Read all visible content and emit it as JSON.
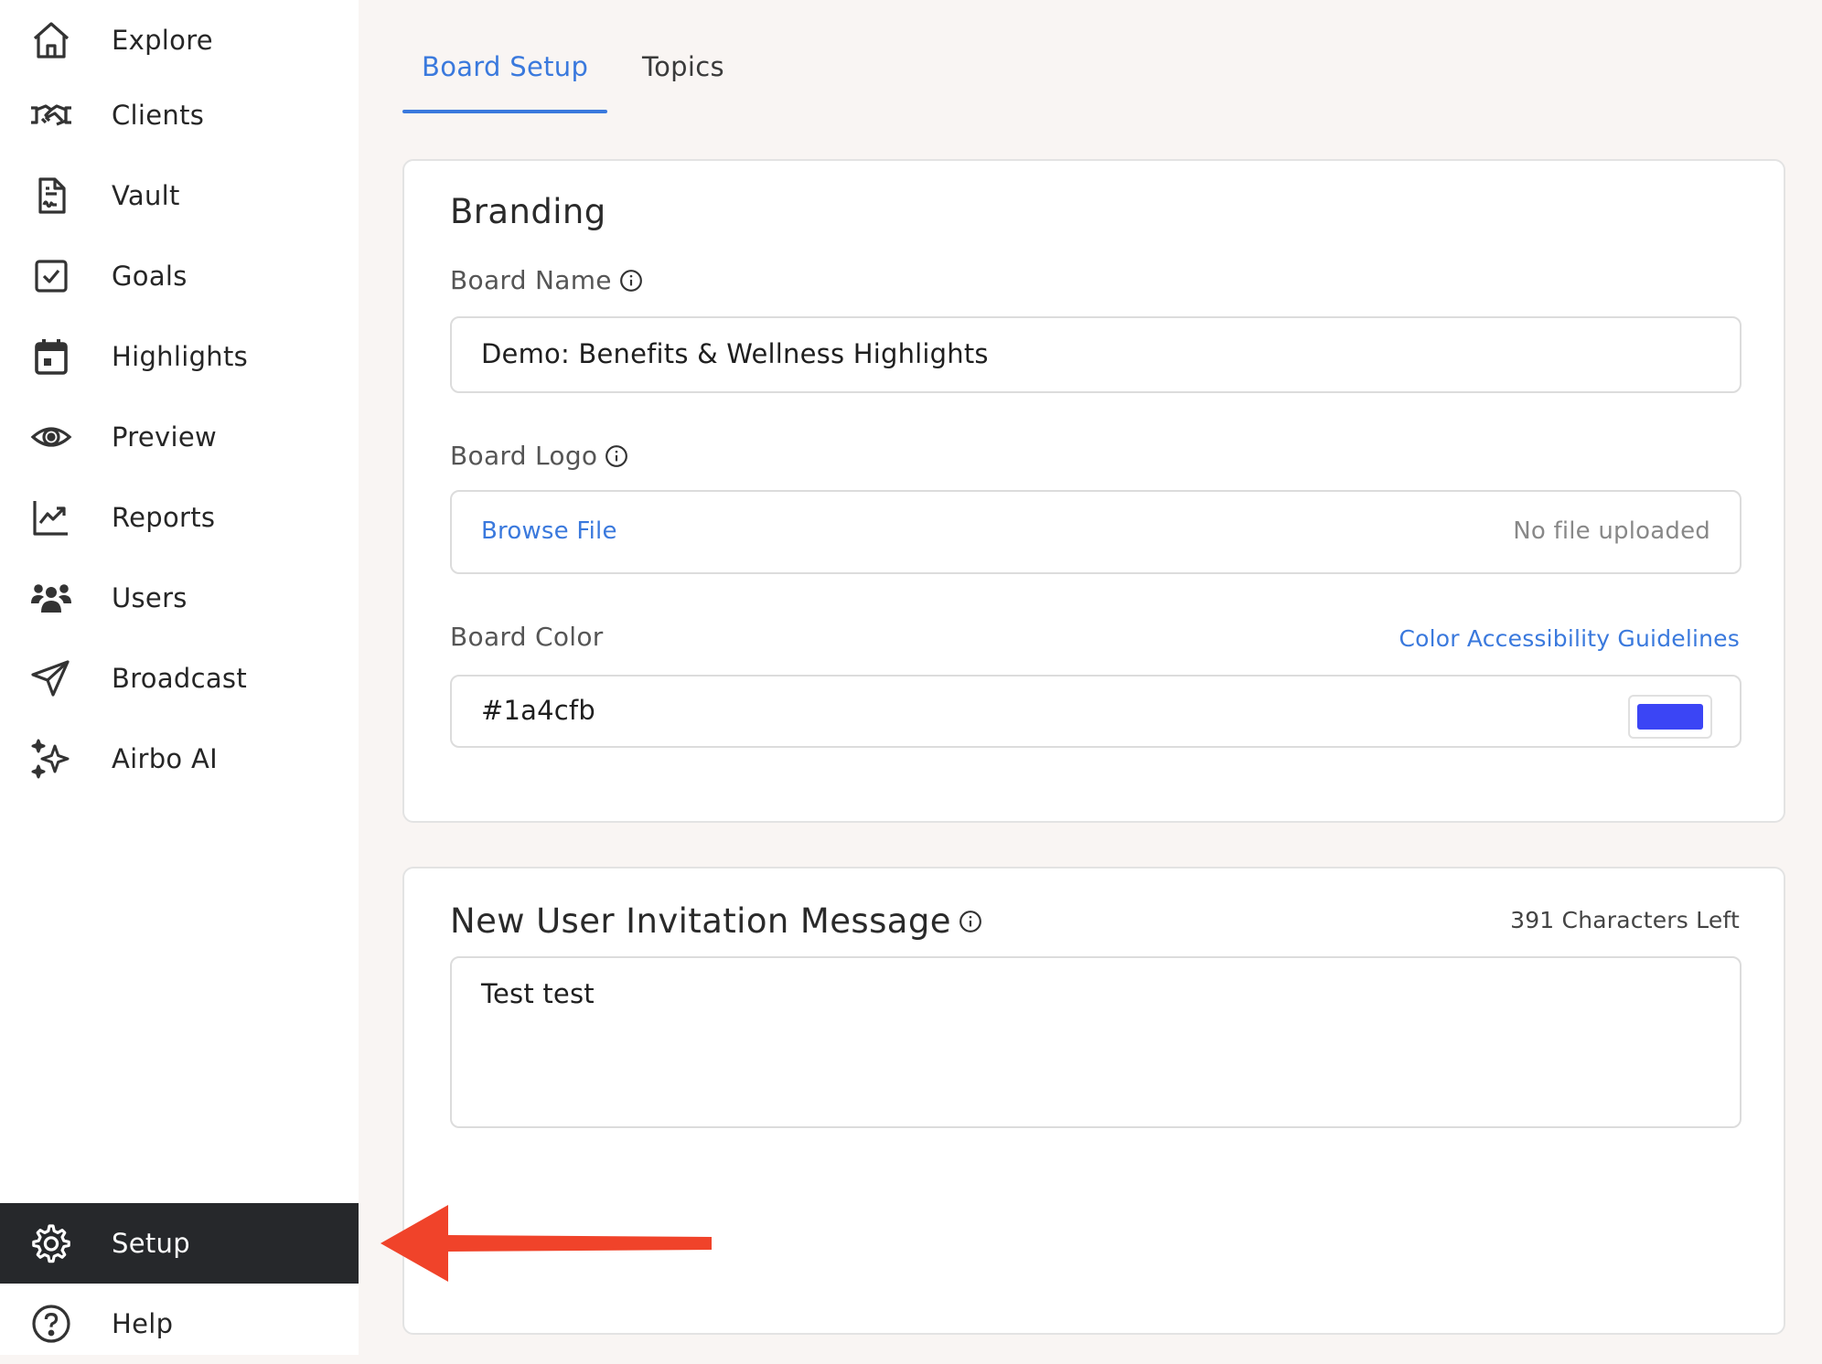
{
  "sidebar": {
    "items": [
      {
        "label": "Explore",
        "icon": "home-icon"
      },
      {
        "label": "Clients",
        "icon": "handshake-icon"
      },
      {
        "label": "Vault",
        "icon": "document-icon"
      },
      {
        "label": "Goals",
        "icon": "checkbox-icon"
      },
      {
        "label": "Highlights",
        "icon": "calendar-icon"
      },
      {
        "label": "Preview",
        "icon": "eye-icon"
      },
      {
        "label": "Reports",
        "icon": "chart-trend-icon"
      },
      {
        "label": "Users",
        "icon": "users-icon"
      },
      {
        "label": "Broadcast",
        "icon": "send-icon"
      },
      {
        "label": "Airbo AI",
        "icon": "sparkles-icon"
      }
    ],
    "setup": {
      "label": "Setup",
      "icon": "gear-icon",
      "active": true
    },
    "help": {
      "label": "Help",
      "icon": "question-circle-icon"
    }
  },
  "tabs": [
    {
      "label": "Board Setup",
      "active": true
    },
    {
      "label": "Topics",
      "active": false
    }
  ],
  "branding": {
    "title": "Branding",
    "board_name_label": "Board Name",
    "board_name_value": "Demo: Benefits & Wellness Highlights",
    "board_logo_label": "Board Logo",
    "browse_file": "Browse File",
    "no_file": "No file uploaded",
    "board_color_label": "Board Color",
    "color_guidelines_link": "Color Accessibility Guidelines",
    "board_color_value": "#1a4cfb",
    "swatch_color": "#3b45f5"
  },
  "invitation": {
    "title": "New User Invitation Message",
    "chars_left": "391 Characters Left",
    "message": "Test test"
  },
  "colors": {
    "accent": "#3a79dd",
    "active_nav_bg": "#26282b",
    "annotation_arrow": "#f0432a"
  }
}
